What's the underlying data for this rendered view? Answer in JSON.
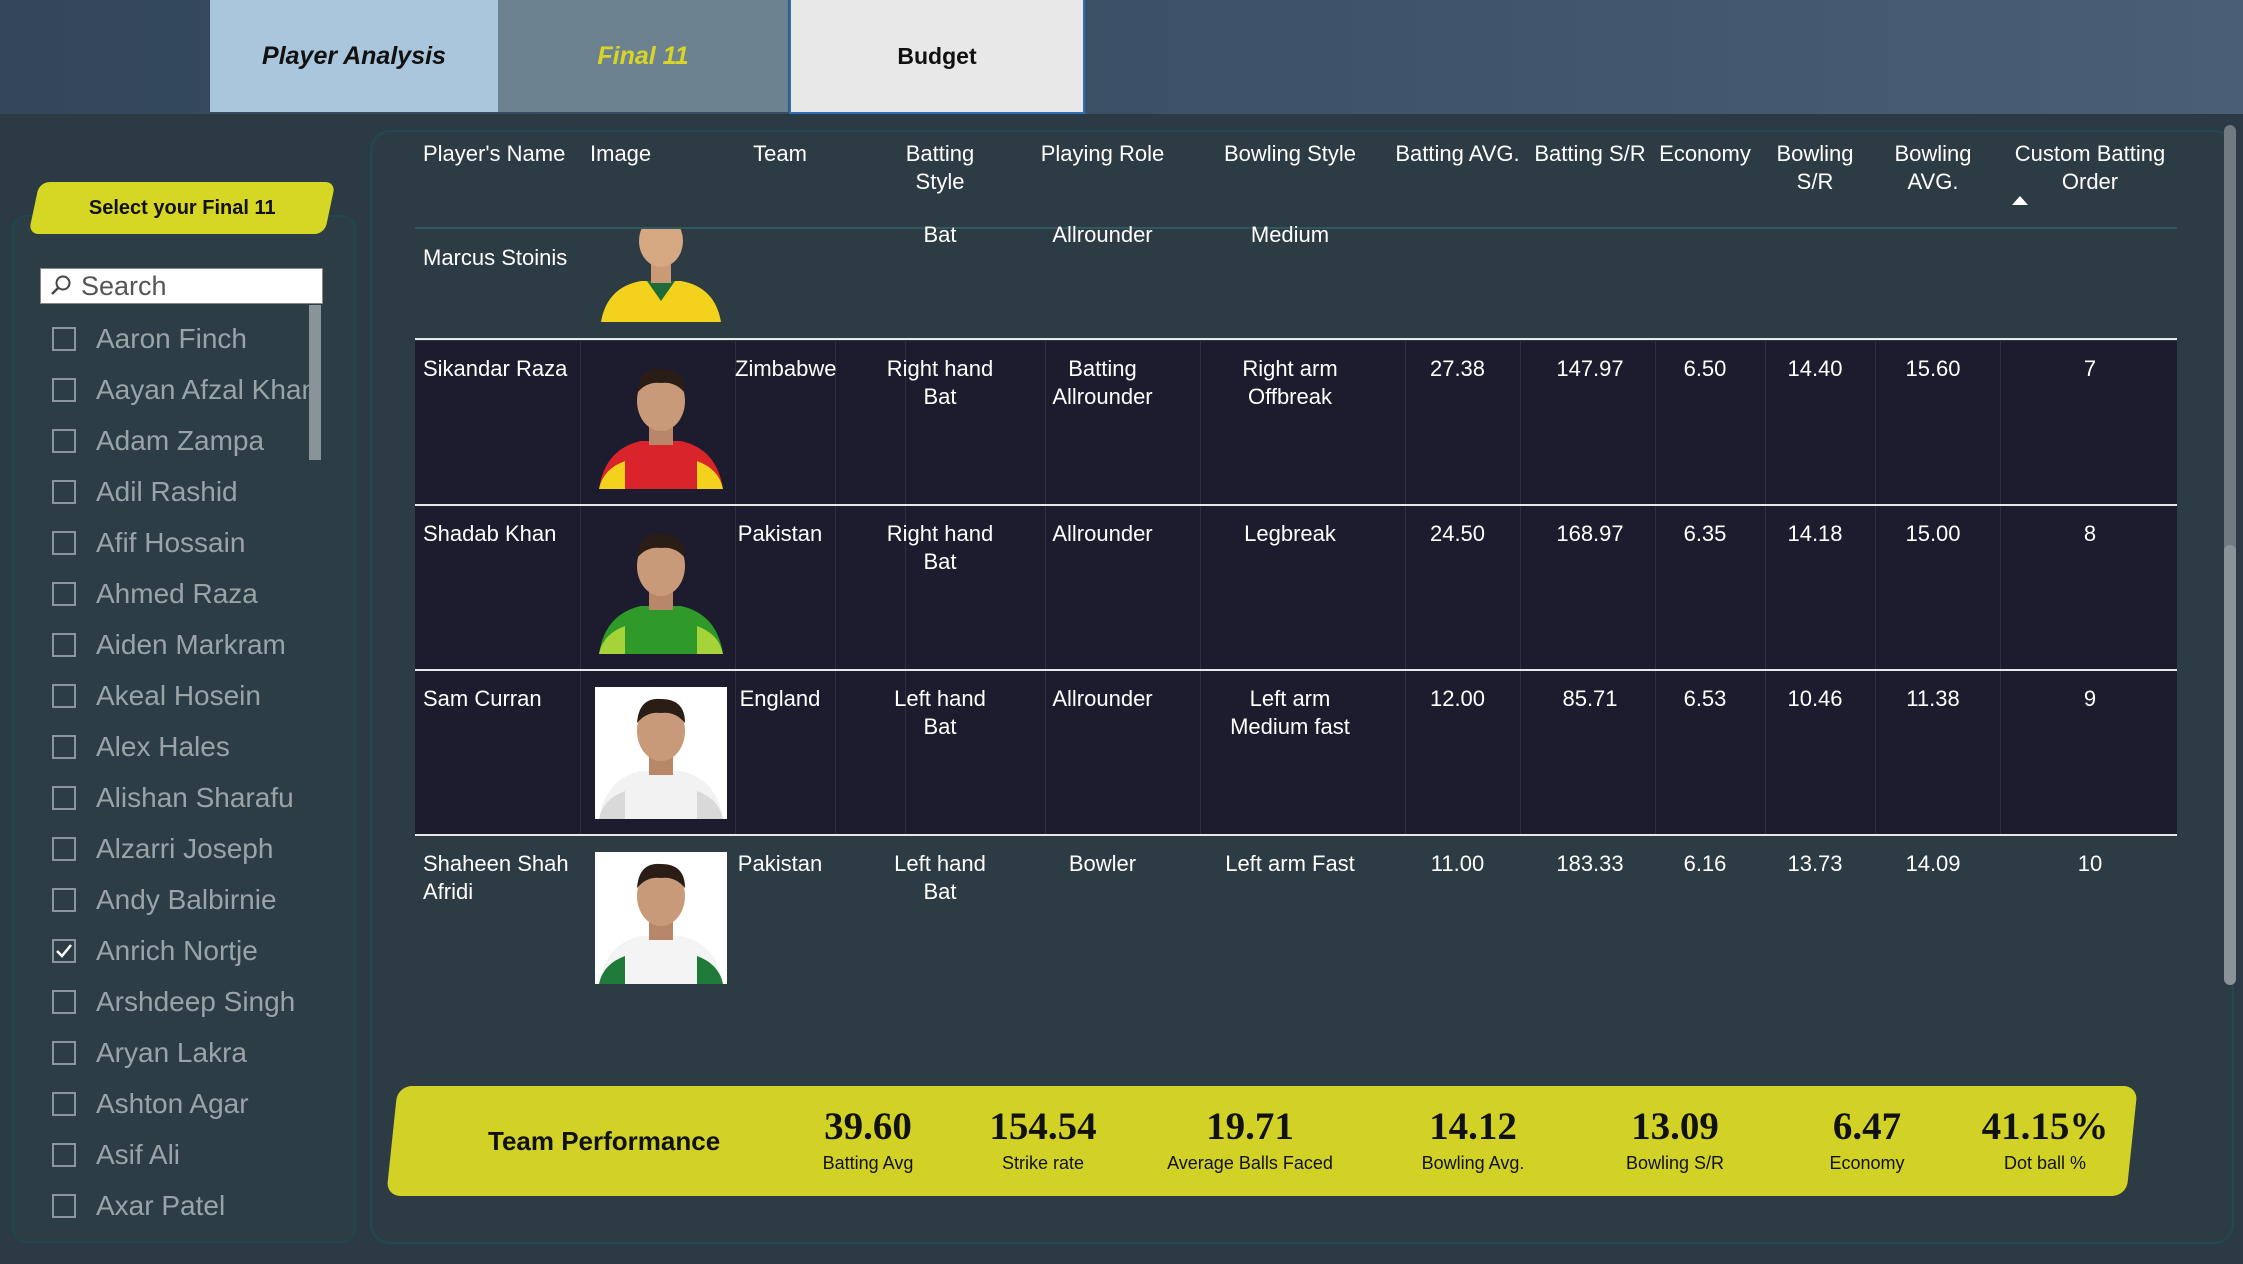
{
  "tabs": {
    "analysis": "Player Analysis",
    "final": "Final 11",
    "budget": "Budget"
  },
  "slicer": {
    "title": "Select your Final 11",
    "search_placeholder": "Search",
    "items": [
      {
        "label": "Aaron Finch",
        "checked": false
      },
      {
        "label": "Aayan Afzal Khan",
        "checked": false
      },
      {
        "label": "Adam Zampa",
        "checked": false
      },
      {
        "label": "Adil Rashid",
        "checked": false
      },
      {
        "label": "Afif Hossain",
        "checked": false
      },
      {
        "label": "Ahmed Raza",
        "checked": false
      },
      {
        "label": "Aiden Markram",
        "checked": false
      },
      {
        "label": "Akeal Hosein",
        "checked": false
      },
      {
        "label": "Alex Hales",
        "checked": false
      },
      {
        "label": "Alishan Sharafu",
        "checked": false
      },
      {
        "label": "Alzarri Joseph",
        "checked": false
      },
      {
        "label": "Andy Balbirnie",
        "checked": false
      },
      {
        "label": "Anrich Nortje",
        "checked": true
      },
      {
        "label": "Arshdeep Singh",
        "checked": false
      },
      {
        "label": "Aryan Lakra",
        "checked": false
      },
      {
        "label": "Ashton Agar",
        "checked": false
      },
      {
        "label": "Asif Ali",
        "checked": false
      },
      {
        "label": "Axar Patel",
        "checked": false
      }
    ]
  },
  "table": {
    "headers": {
      "name": "Player's Name",
      "image": "Image",
      "team": "Team",
      "batting_style_1": "Batting",
      "batting_style_2": "Style",
      "role": "Playing Role",
      "bowling_style": "Bowling Style",
      "bat_avg": "Batting AVG.",
      "bat_sr": "Batting S/R",
      "economy": "Economy",
      "bowl_sr_1": "Bowling",
      "bowl_sr_2": "S/R",
      "bowl_avg_1": "Bowling",
      "bowl_avg_2": "AVG.",
      "order_1": "Custom Batting",
      "order_2": "Order"
    },
    "partial_row": {
      "name": "Marcus Stoinis",
      "batting_style": "Bat",
      "role": "Allrounder",
      "bowling_style": "Medium"
    },
    "rows": [
      {
        "name_1": "Sikandar Raza",
        "name_2": "",
        "team": "Zimbabwe",
        "bs_1": "Right hand",
        "bs_2": "Bat",
        "role_1": "Batting",
        "role_2": "Allrounder",
        "bowl_1": "Right arm",
        "bowl_2": "Offbreak",
        "bat_avg": "27.38",
        "bat_sr": "147.97",
        "economy": "6.50",
        "bowl_sr": "14.40",
        "bowl_avg": "15.60",
        "order": "7",
        "jersey": "#d8242a",
        "jersey2": "#f2d21c"
      },
      {
        "name_1": "Shadab Khan",
        "name_2": "",
        "team": "Pakistan",
        "bs_1": "Right hand",
        "bs_2": "Bat",
        "role_1": "Allrounder",
        "role_2": "",
        "bowl_1": "Legbreak",
        "bowl_2": "",
        "bat_avg": "24.50",
        "bat_sr": "168.97",
        "economy": "6.35",
        "bowl_sr": "14.18",
        "bowl_avg": "15.00",
        "order": "8",
        "jersey": "#2f9a2a",
        "jersey2": "#a6d23a"
      },
      {
        "name_1": "Sam Curran",
        "name_2": "",
        "team": "England",
        "bs_1": "Left hand",
        "bs_2": "Bat",
        "role_1": "Allrounder",
        "role_2": "",
        "bowl_1": "Left arm",
        "bowl_2": "Medium fast",
        "bat_avg": "12.00",
        "bat_sr": "85.71",
        "economy": "6.53",
        "bowl_sr": "10.46",
        "bowl_avg": "11.38",
        "order": "9",
        "jersey": "#f2f2f2",
        "jersey2": "#d9d9d9"
      },
      {
        "name_1": "Shaheen Shah",
        "name_2": "Afridi",
        "team": "Pakistan",
        "bs_1": "Left hand",
        "bs_2": "Bat",
        "role_1": "Bowler",
        "role_2": "",
        "bowl_1": "Left arm Fast",
        "bowl_2": "",
        "bat_avg": "11.00",
        "bat_sr": "183.33",
        "economy": "6.16",
        "bowl_sr": "13.73",
        "bowl_avg": "14.09",
        "order": "10",
        "jersey": "#f4f4f4",
        "jersey2": "#1f7a3a"
      }
    ]
  },
  "performance": {
    "title": "Team Performance",
    "kpis": [
      {
        "value": "39.60",
        "label": "Batting Avg"
      },
      {
        "value": "154.54",
        "label": "Strike rate"
      },
      {
        "value": "19.71",
        "label": "Average Balls Faced"
      },
      {
        "value": "14.12",
        "label": "Bowling Avg."
      },
      {
        "value": "13.09",
        "label": "Bowling S/R"
      },
      {
        "value": "6.47",
        "label": "Economy"
      },
      {
        "value": "41.15%",
        "label": "Dot ball %"
      }
    ]
  },
  "colors": {
    "accent_yellow": "#d2d226",
    "row_dark": "#1c1c2e",
    "panel": "#2d3b44"
  }
}
